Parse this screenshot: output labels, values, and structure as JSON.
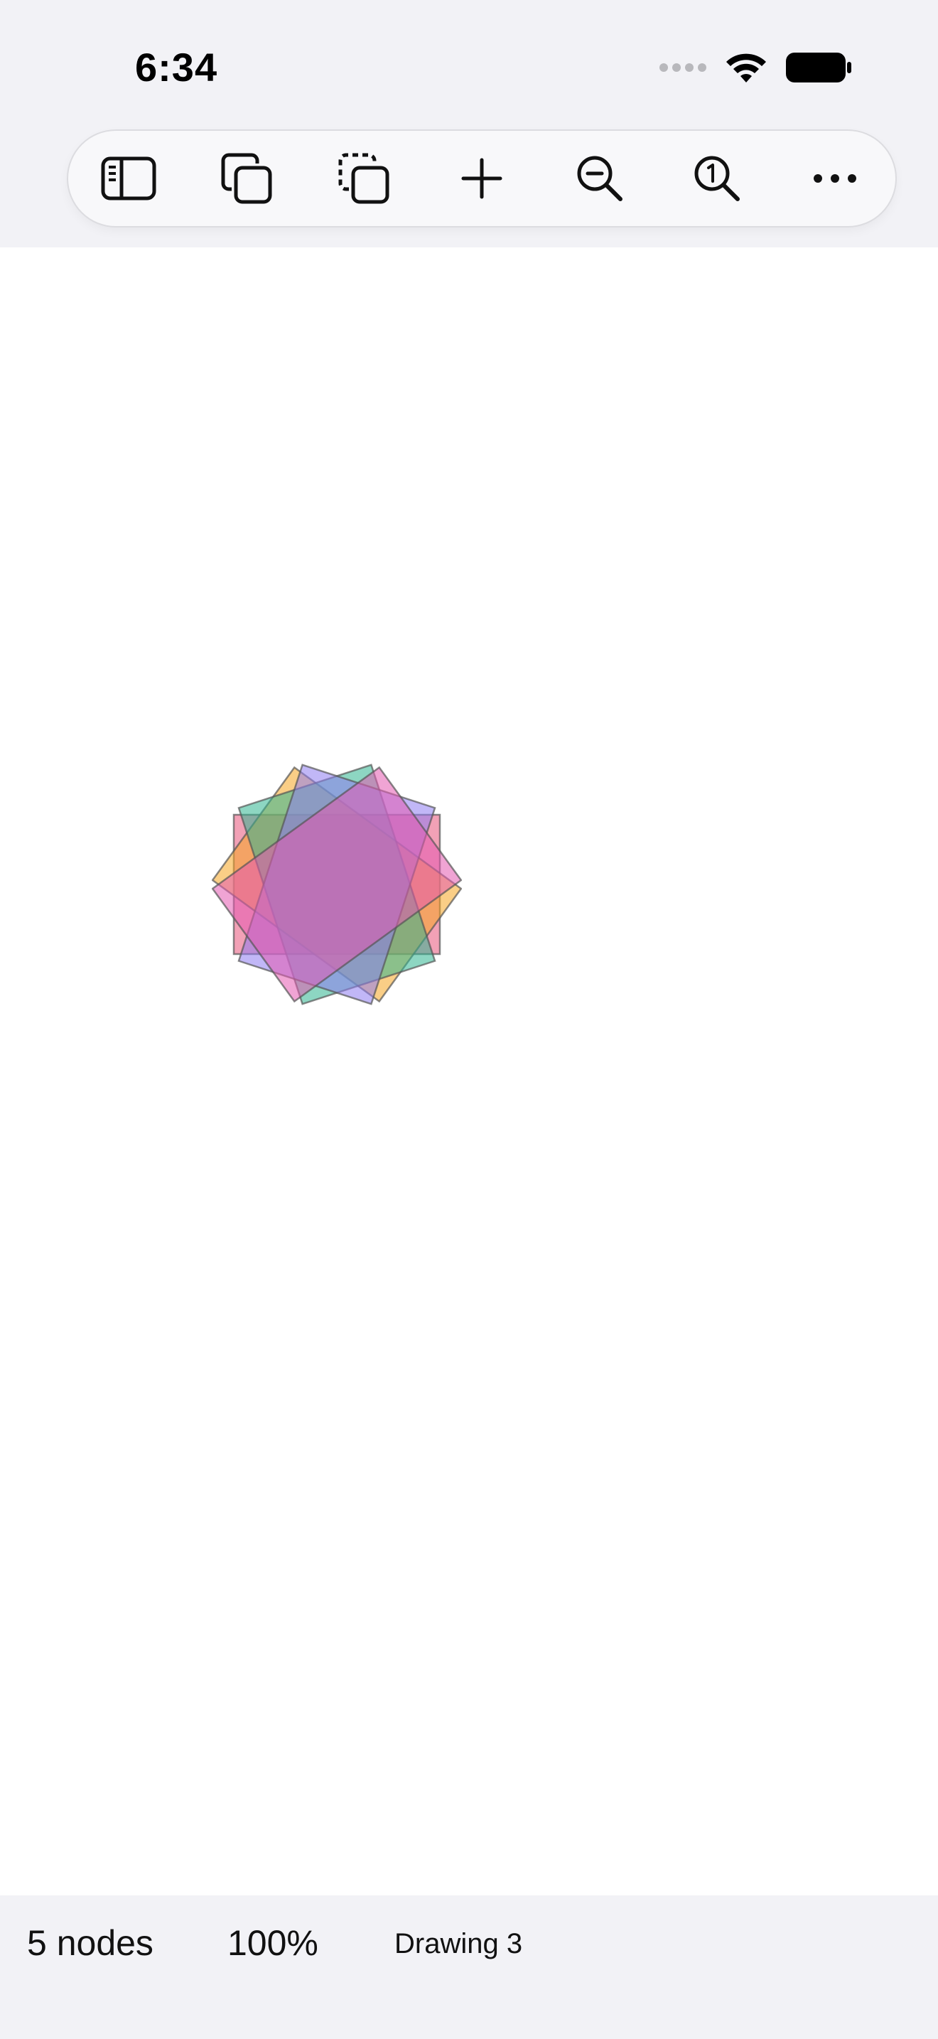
{
  "status_bar": {
    "time": "6:34"
  },
  "toolbar": {
    "buttons": [
      {
        "icon": "sidebar-icon"
      },
      {
        "icon": "duplicate-icon"
      },
      {
        "icon": "duplicate-dashed-icon"
      },
      {
        "icon": "plus-icon"
      },
      {
        "icon": "zoom-out-icon"
      },
      {
        "icon": "zoom-actual-size-icon"
      },
      {
        "icon": "more-icon"
      }
    ]
  },
  "canvas": {
    "shapes": [
      {
        "name": "rect-red",
        "color": "#e8547a"
      },
      {
        "name": "rect-orange",
        "color": "#f5a623"
      },
      {
        "name": "rect-green",
        "color": "#2fb58f"
      },
      {
        "name": "rect-purple",
        "color": "#8e7cf0"
      },
      {
        "name": "rect-pink",
        "color": "#e45ab0"
      }
    ]
  },
  "bottom_bar": {
    "node_count": "5 nodes",
    "zoom": "100%",
    "document_name": "Drawing 3"
  }
}
